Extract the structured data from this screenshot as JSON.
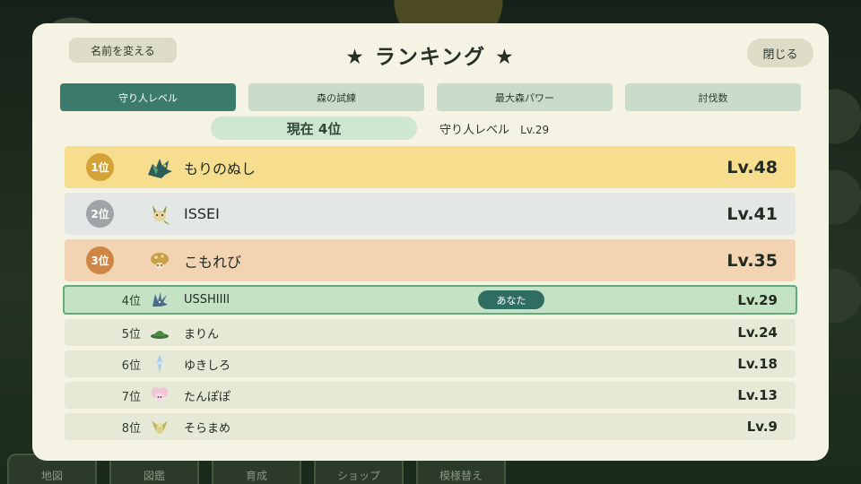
{
  "header": {
    "rename_label": "名前を変える",
    "title": "★ ランキング ★",
    "close_label": "閉じる"
  },
  "tabs": [
    {
      "label": "守り人レベル",
      "active": true
    },
    {
      "label": "森の試練",
      "active": false
    },
    {
      "label": "最大森パワー",
      "active": false
    },
    {
      "label": "討伐数",
      "active": false
    }
  ],
  "current": {
    "rank_text": "現在 4位",
    "category": "守り人レベル",
    "level": "Lv.29"
  },
  "rankings": [
    {
      "rank": "1位",
      "name": "もりのぬし",
      "level": "Lv.48",
      "icon": "dragon-icon"
    },
    {
      "rank": "2位",
      "name": "ISSEI",
      "level": "Lv.41",
      "icon": "leaf-fox-icon"
    },
    {
      "rank": "3位",
      "name": "こもれび",
      "level": "Lv.35",
      "icon": "mushroom-icon"
    },
    {
      "rank": "4位",
      "name": "USSHIIII",
      "level": "Lv.29",
      "icon": "spiky-creature-icon",
      "you_label": "あなた"
    },
    {
      "rank": "5位",
      "name": "まりん",
      "level": "Lv.24",
      "icon": "green-hat-icon"
    },
    {
      "rank": "6位",
      "name": "ゆきしろ",
      "level": "Lv.18",
      "icon": "snow-crystal-icon"
    },
    {
      "rank": "7位",
      "name": "たんぽぽ",
      "level": "Lv.13",
      "icon": "pink-fairy-icon"
    },
    {
      "rank": "8位",
      "name": "そらまめ",
      "level": "Lv.9",
      "icon": "winged-sprite-icon"
    }
  ],
  "bottom_nav": [
    "地図",
    "図鑑",
    "育成",
    "ショップ",
    "模様替え"
  ],
  "colors": {
    "active_tab": "#3c7a6c",
    "gold": "#d4a337",
    "silver": "#9fa5a6",
    "bronze": "#cf8544",
    "self_highlight": "#c4e2c4"
  }
}
